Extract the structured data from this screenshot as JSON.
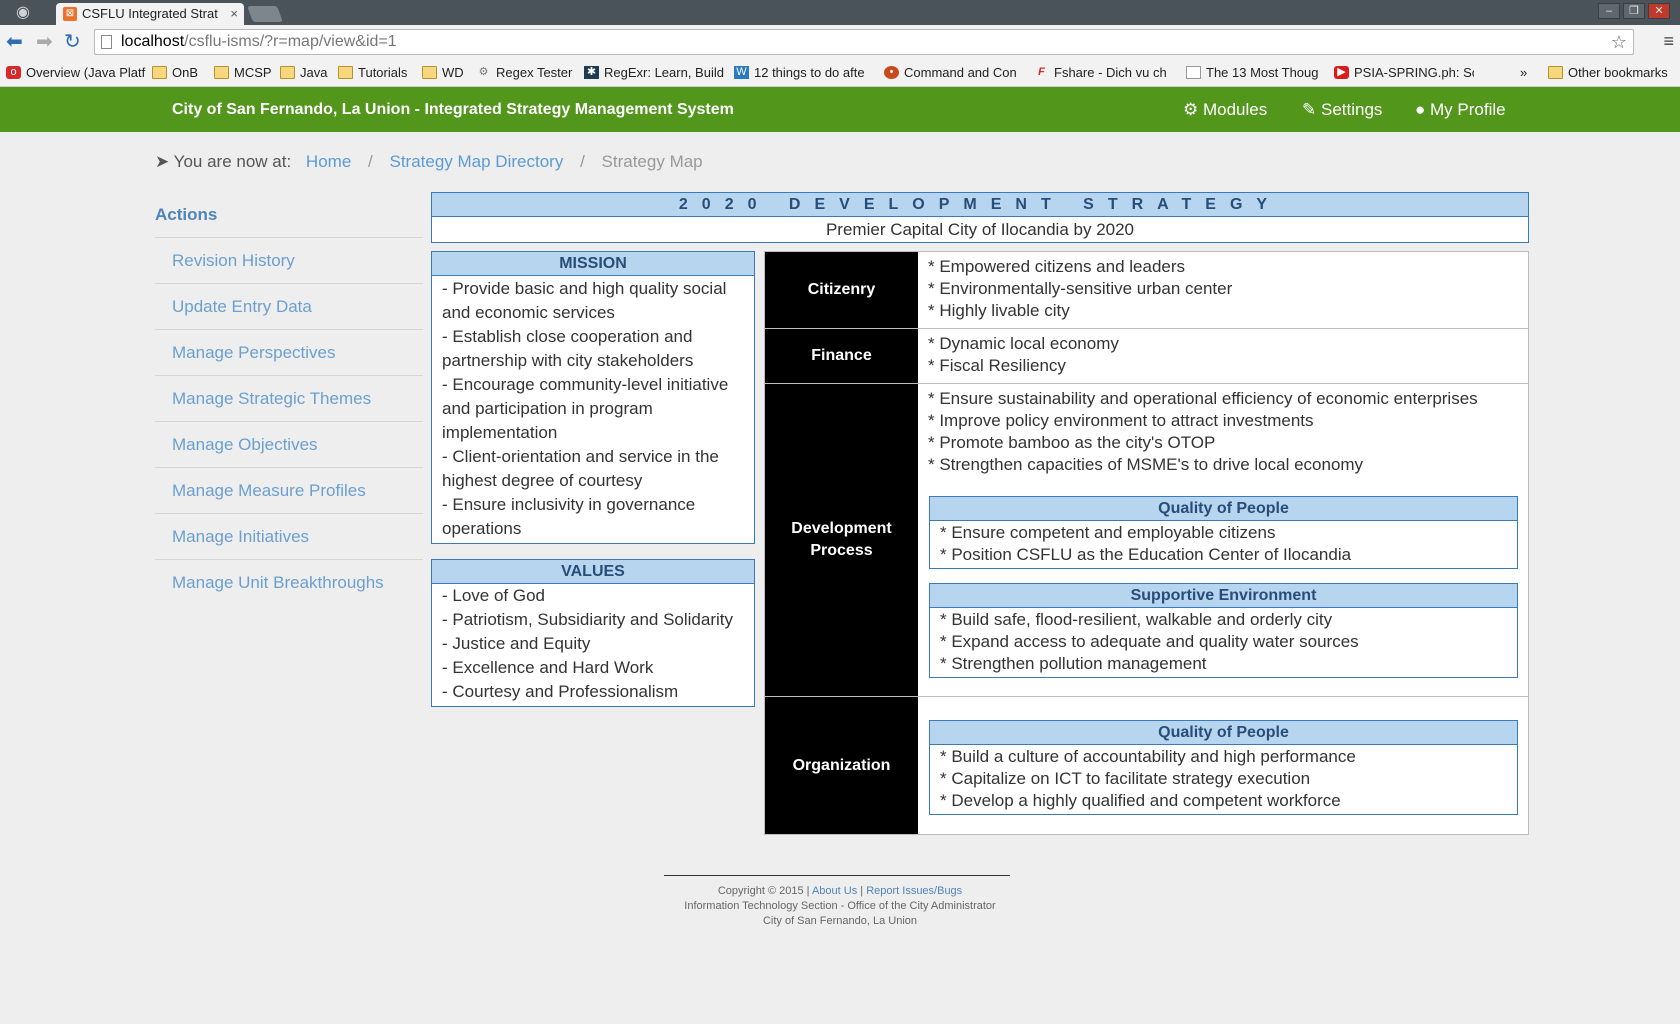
{
  "browser": {
    "tab_title": "CSFLU Integrated Strat",
    "url_host": "localhost",
    "url_path": "/csflu-isms/?r=map/view&id=1",
    "bookmarks": [
      "Overview (Java Platf",
      "OnB",
      "MCSP",
      "Java",
      "Tutorials",
      "WD",
      "Regex Tester",
      "RegExr: Learn, Build",
      "12 things to do afte",
      "Command and Con",
      "Fshare - Dich vu ch",
      "The 13 Most Thoug",
      "PSIA-SPRING.ph: Sc",
      "»",
      "Other bookmarks"
    ]
  },
  "header": {
    "brand": "City of San Fernando, La Union - Integrated Strategy Management System",
    "nav": [
      "Modules",
      "Settings",
      "My Profile"
    ]
  },
  "breadcrumb": {
    "prefix": "You are now at:",
    "items": [
      "Home",
      "Strategy Map Directory",
      "Strategy Map"
    ]
  },
  "sidebar": {
    "heading": "Actions",
    "items": [
      "Revision History",
      "Update Entry Data",
      "Manage Perspectives",
      "Manage Strategic Themes",
      "Manage Objectives",
      "Manage Measure Profiles",
      "Manage Initiatives",
      "Manage Unit Breakthroughs"
    ]
  },
  "strategy": {
    "title": "2020 DEVELOPMENT STRATEGY",
    "vision": "Premier Capital City of Ilocandia by 2020"
  },
  "mission": {
    "heading": "MISSION",
    "lines": [
      "- Provide basic and high quality social",
      "and economic services",
      "- Establish close cooperation and",
      "partnership with city stakeholders",
      "- Encourage community-level initiative",
      "and participation in program",
      "implementation",
      "- Client-orientation and service in the",
      "highest degree of courtesy",
      "- Ensure inclusivity in governance",
      "operations"
    ]
  },
  "values": {
    "heading": "VALUES",
    "lines": [
      "- Love of God",
      "- Patriotism, Subsidiarity and Solidarity",
      "- Justice and Equity",
      "- Excellence and Hard Work",
      "- Courtesy and Professionalism"
    ]
  },
  "perspectives": [
    {
      "name": "Citizenry",
      "objectives": [
        "* Empowered citizens and leaders",
        "* Environmentally-sensitive urban center",
        "* Highly livable city"
      ]
    },
    {
      "name": "Finance",
      "objectives": [
        "* Dynamic local economy",
        "* Fiscal Resiliency"
      ]
    },
    {
      "name_line1": "Development",
      "name_line2": "Process",
      "objectives": [
        "* Ensure sustainability and operational efficiency of economic enterprises",
        "* Improve policy environment to attract investments",
        "* Promote bamboo as the city's OTOP",
        "* Strengthen capacities of MSME's to drive local economy"
      ],
      "themes": [
        {
          "name": "Quality of People",
          "objectives": [
            "* Ensure competent and employable citizens",
            "* Position CSFLU as the Education Center of Ilocandia"
          ]
        },
        {
          "name": "Supportive Environment",
          "objectives": [
            "* Build safe, flood-resilient, walkable and orderly city",
            "* Expand access to adequate and quality water sources",
            "* Strengthen pollution management"
          ]
        }
      ]
    },
    {
      "name": "Organization",
      "themes": [
        {
          "name": "Quality of People",
          "objectives": [
            "* Build a culture of accountability and high performance",
            "* Capitalize on ICT to facilitate strategy execution",
            "* Develop a highly qualified and competent workforce"
          ]
        }
      ]
    }
  ],
  "footer": {
    "copyright": "Copyright © 2015",
    "about": "About Us",
    "report": "Report Issues/Bugs",
    "sep": "|",
    "line2": "Information Technology Section - Office of the City Administrator",
    "line3": "City of San Fernando, La Union"
  },
  "colors": {
    "appbar": "#52961c",
    "accent_blue": "#3b7ab8",
    "panel_header": "#b8d5f0",
    "link": "#5b9bd5"
  }
}
